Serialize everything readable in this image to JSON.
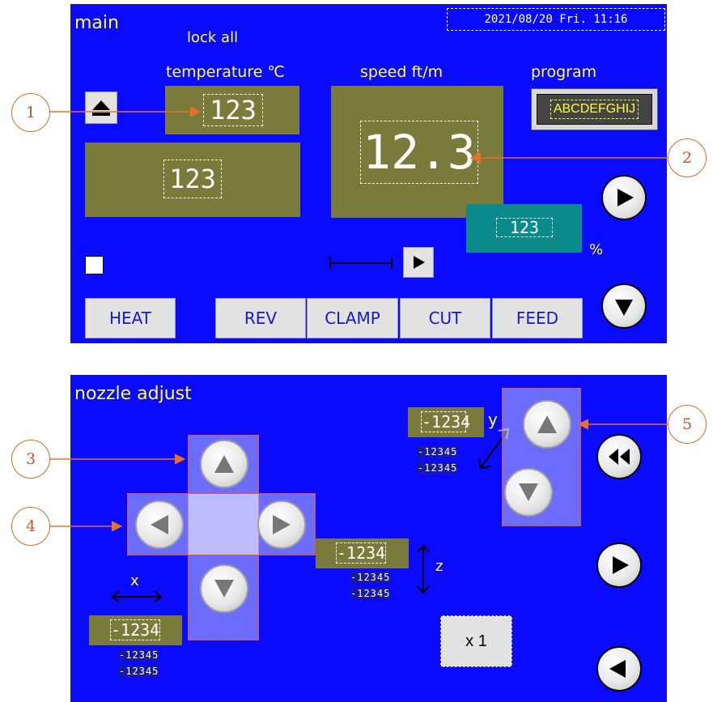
{
  "main_panel": {
    "title": "main",
    "datetime": "2021/08/20 Fri. 11:16",
    "lock_label": "lock all",
    "temperature_label": "temperature ℃",
    "speed_label": "speed ft/m",
    "program_label": "program",
    "program_value": "ABCDEFGHIJ",
    "temp_top_value": "123",
    "temp_bottom_value": "123",
    "speed_value": "12.3",
    "percent_value": "123",
    "percent_unit": "%",
    "buttons": [
      "HEAT",
      "REV",
      "CLAMP",
      "CUT",
      "FEED"
    ]
  },
  "nozzle_panel": {
    "title": "nozzle adjust",
    "y_label": "y",
    "z_label": "z",
    "x_label": "x",
    "y_value": "-1234",
    "z_value": "-1234",
    "x_value": "-1234",
    "y_sub": [
      "-12345",
      "-12345"
    ],
    "z_sub": [
      "-12345",
      "-12345"
    ],
    "x_sub": [
      "-12345",
      "-12345"
    ],
    "multiplier": "x 1"
  },
  "callouts": [
    "1",
    "2",
    "3",
    "4",
    "5"
  ],
  "colors": {
    "panel": "#0a0aff",
    "text_accent": "#ffff33",
    "display_bg": "#7a7a3a",
    "percent_bg": "#0a8a8a",
    "callout": "#e8702a",
    "button_text": "#1818c8"
  }
}
